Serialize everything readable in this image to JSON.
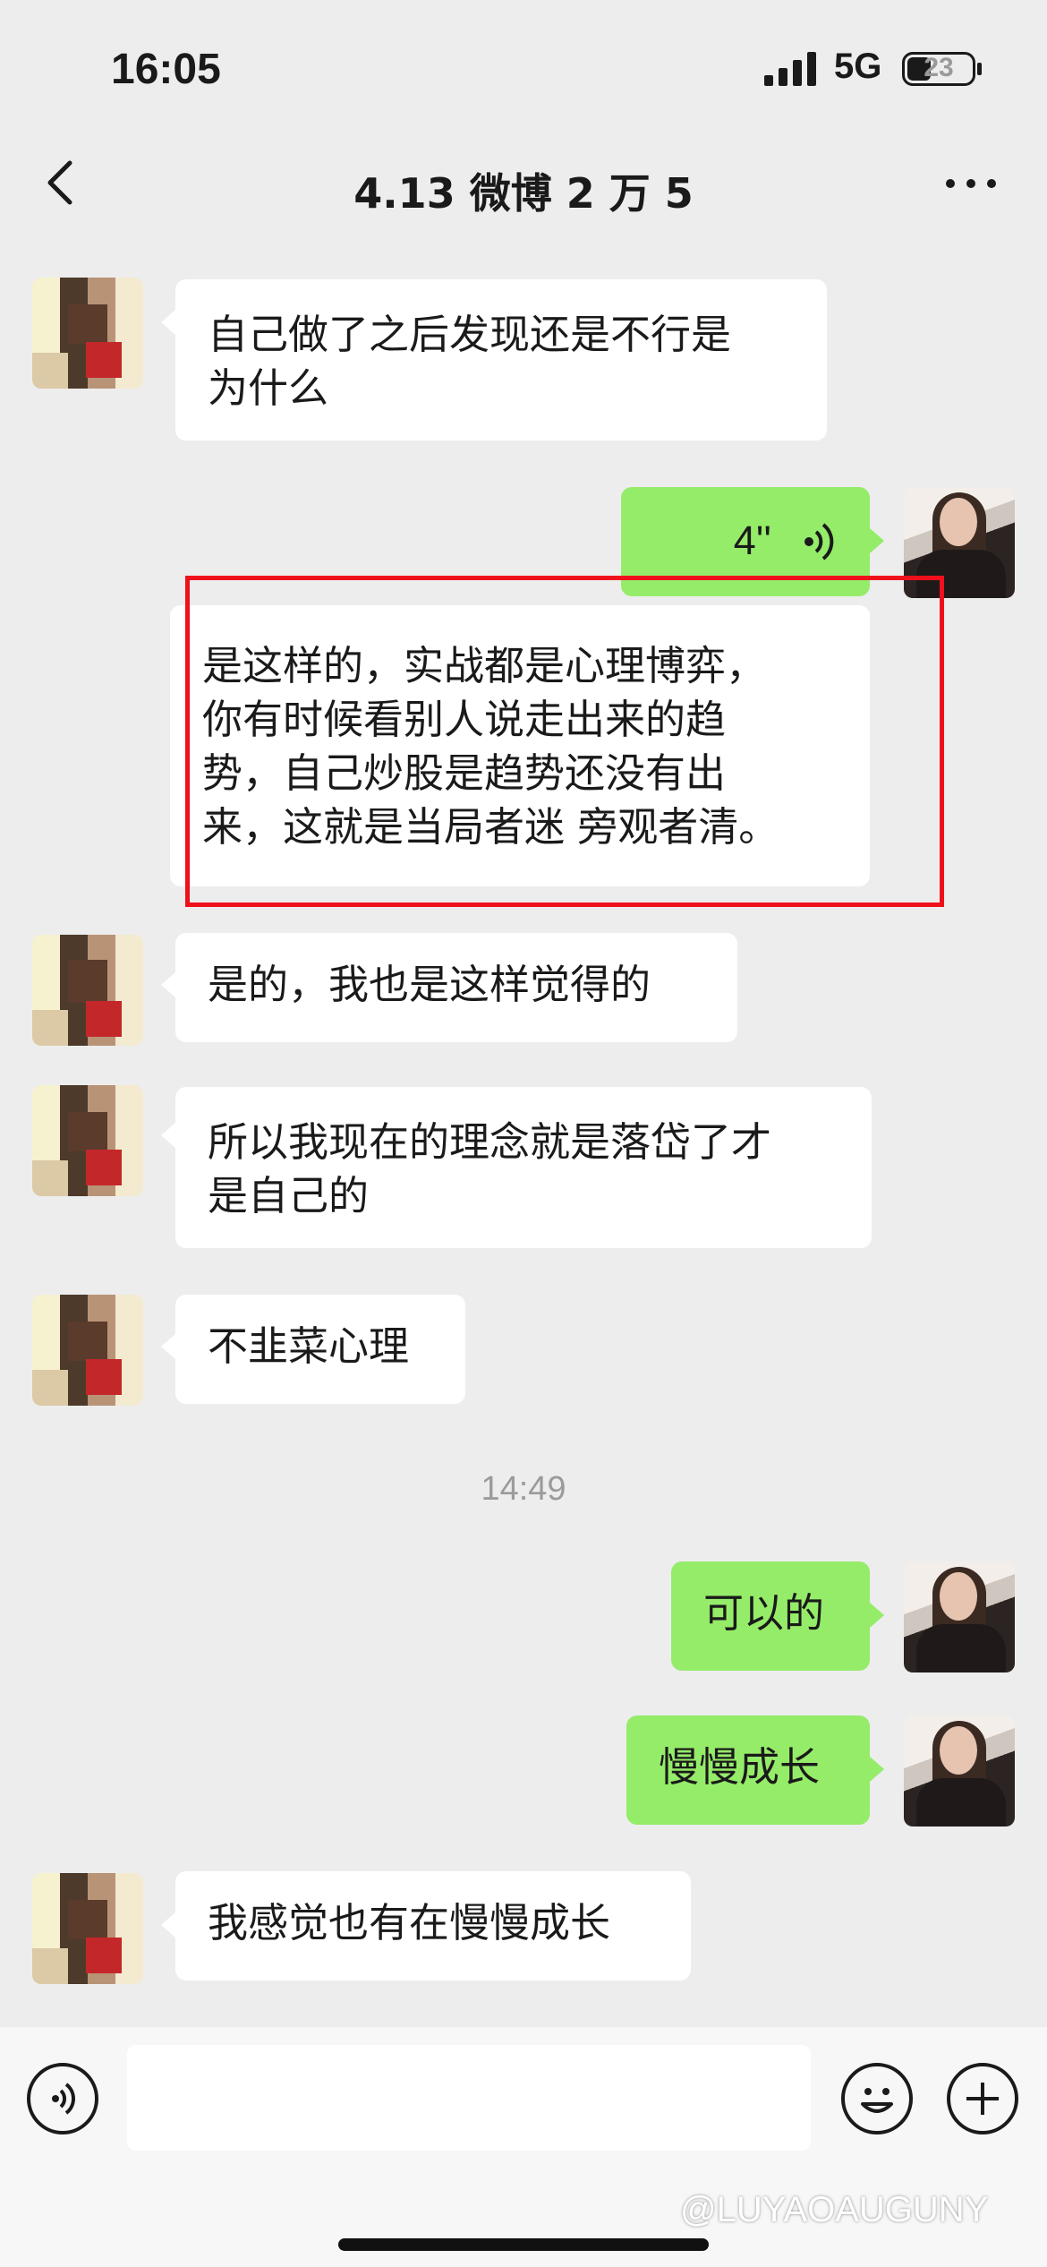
{
  "status_bar": {
    "time": "16:05",
    "network": "5G",
    "battery": "23"
  },
  "header": {
    "title": "4.13 微博 2 万 5"
  },
  "messages": [
    {
      "side": "left",
      "text_lines": [
        "自己做了之后发现还是不行是",
        "为什么"
      ]
    },
    {
      "side": "right",
      "type": "voice",
      "duration": "4''"
    },
    {
      "side": "left",
      "highlighted": true,
      "text_lines": [
        "是这样的，实战都是心理博弈，",
        "你有时候看别人说走出来的趋",
        "势，自己炒股是趋势还没有出",
        "来，这就是当局者迷 旁观者清。"
      ]
    },
    {
      "side": "left",
      "text_lines": [
        "是的，我也是这样觉得的"
      ]
    },
    {
      "side": "left",
      "text_lines": [
        "所以我现在的理念就是落岱了才",
        "是自己的"
      ]
    },
    {
      "side": "left",
      "text_lines": [
        "不韭菜心理"
      ]
    },
    {
      "side": "right",
      "text_lines": [
        "可以的"
      ]
    },
    {
      "side": "right",
      "text_lines": [
        "慢慢成长"
      ]
    },
    {
      "side": "left",
      "text_lines": [
        "我感觉也有在慢慢成长"
      ]
    }
  ],
  "timestamp": "14:49",
  "watermark": "@LUYAOAUGUNY",
  "colors": {
    "background": "#ededed",
    "bubble_self": "#95ec69",
    "bubble_other": "#ffffff",
    "highlight_box": "#f0101c"
  }
}
